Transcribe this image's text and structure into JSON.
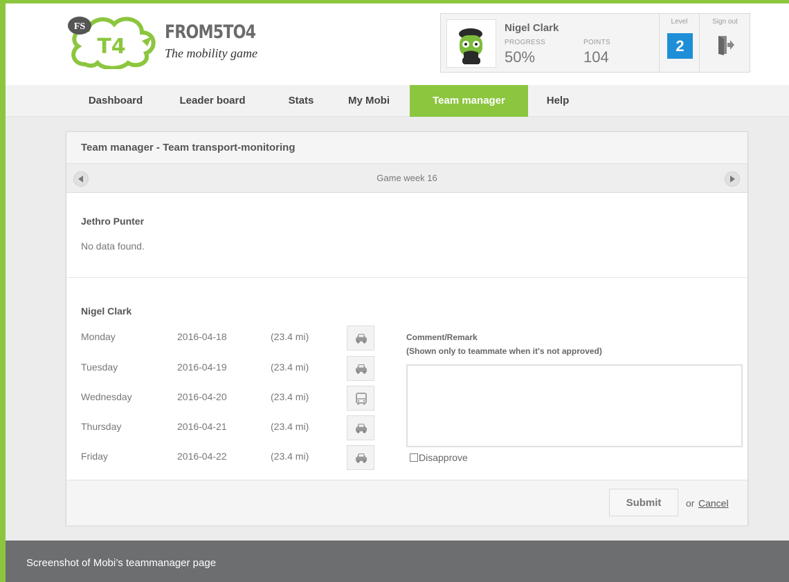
{
  "app": {
    "logo_badge": "FS",
    "logo_mark": "T4",
    "logo_title": "FROM5TO4",
    "logo_subtitle": "The mobility game"
  },
  "profile": {
    "name": "Nigel Clark",
    "progress_label": "PROGRESS",
    "progress_value": "50%",
    "points_label": "POINTS",
    "points_value": "104",
    "level_label": "Level",
    "level_value": "2",
    "signout_label": "Sign out"
  },
  "nav": {
    "items": [
      {
        "label": "Dashboard",
        "active": false
      },
      {
        "label": "Leader board",
        "active": false
      },
      {
        "label": "Stats",
        "active": false
      },
      {
        "label": "My Mobi",
        "active": false
      },
      {
        "label": "Team manager",
        "active": true
      },
      {
        "label": "Help",
        "active": false
      }
    ]
  },
  "panel": {
    "title": "Team manager - Team transport-monitoring",
    "week_label": "Game week 16"
  },
  "members": [
    {
      "name": "Jethro Punter",
      "message": "No data found."
    },
    {
      "name": "Nigel Clark",
      "days": [
        {
          "day": "Monday",
          "date": "2016-04-18",
          "distance": "(23.4 mi)",
          "transport": "car-icon"
        },
        {
          "day": "Tuesday",
          "date": "2016-04-19",
          "distance": "(23.4 mi)",
          "transport": "car-icon"
        },
        {
          "day": "Wednesday",
          "date": "2016-04-20",
          "distance": "(23.4 mi)",
          "transport": "bus-icon"
        },
        {
          "day": "Thursday",
          "date": "2016-04-21",
          "distance": "(23.4 mi)",
          "transport": "car-icon"
        },
        {
          "day": "Friday",
          "date": "2016-04-22",
          "distance": "(23.4 mi)",
          "transport": "car-icon"
        }
      ]
    }
  ],
  "comment": {
    "title": "Comment/Remark",
    "subtitle": "(Shown only to teammate when it's not approved)",
    "value": "",
    "disapprove_label": "Disapprove",
    "disapprove_checked": false
  },
  "actions": {
    "submit_label": "Submit",
    "or_text": "or",
    "cancel_label": "Cancel"
  },
  "caption": "Screenshot of Mobi’s teammanager page",
  "colors": {
    "brand_green": "#8cc63f",
    "level_blue": "#1e8fd6",
    "caption_gray": "#6c6e70"
  }
}
